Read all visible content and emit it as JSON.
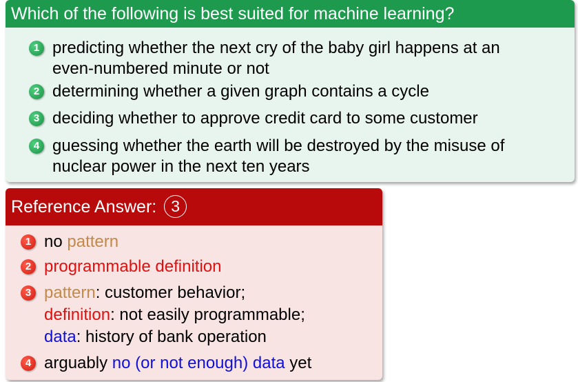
{
  "question": {
    "title": "Which of the following is best suited for machine learning?",
    "options": [
      {
        "number": "1",
        "line1": "predicting whether the next cry of the baby girl happens at an",
        "line2": "even-numbered minute or not"
      },
      {
        "number": "2",
        "line1": "determining whether a given graph contains a cycle"
      },
      {
        "number": "3",
        "line1": "deciding whether to approve credit card to some customer"
      },
      {
        "number": "4",
        "line1": "guessing whether the earth will be destroyed by the misuse of",
        "line2": "nuclear power in the next ten years"
      }
    ]
  },
  "answer": {
    "title": "Reference Answer:",
    "answer_number": "3",
    "items": [
      {
        "number": "1",
        "prefix": "no ",
        "highlight": "pattern"
      },
      {
        "number": "2",
        "highlight": "programmable definition"
      },
      {
        "number": "3",
        "line1_highlight": "pattern",
        "line1_rest": ": customer behavior;",
        "line2_highlight": "definition",
        "line2_rest": ": not easily programmable;",
        "line3_highlight": "data",
        "line3_rest": ": history of bank operation"
      },
      {
        "number": "4",
        "prefix": "arguably ",
        "highlight": "no (or not enough) data",
        "suffix": " yet"
      }
    ]
  },
  "colors": {
    "question_header": "#1e9a4e",
    "question_body": "#e8f4ee",
    "answer_header": "#b80a0a",
    "answer_body": "#f9e4e4",
    "pattern": "#c28a4a",
    "definition": "#e01010",
    "data": "#1010d8"
  }
}
